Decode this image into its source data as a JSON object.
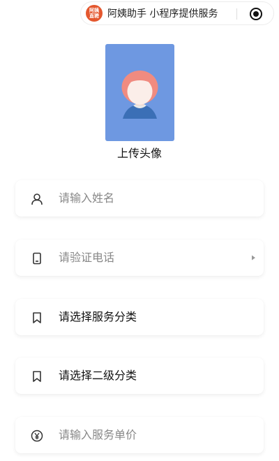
{
  "capsule": {
    "logo_text": "阿姨直聘",
    "title": "阿姨助手 小程序提供服务"
  },
  "avatar": {
    "label": "上传头像"
  },
  "form": {
    "name": {
      "placeholder": "请输入姓名"
    },
    "phone": {
      "placeholder": "请验证电话"
    },
    "category": {
      "label": "请选择服务分类"
    },
    "subcategory": {
      "label": "请选择二级分类"
    },
    "price": {
      "placeholder": "请输入服务单价"
    }
  },
  "colors": {
    "avatar_bg": "#6e98e1",
    "logo_bg": "#e4572e"
  },
  "icons": {
    "name": "user-icon",
    "phone": "phone-icon",
    "category": "bookmark-icon",
    "subcategory": "bookmark-icon",
    "price": "yen-icon",
    "capsule_action": "target-icon"
  }
}
